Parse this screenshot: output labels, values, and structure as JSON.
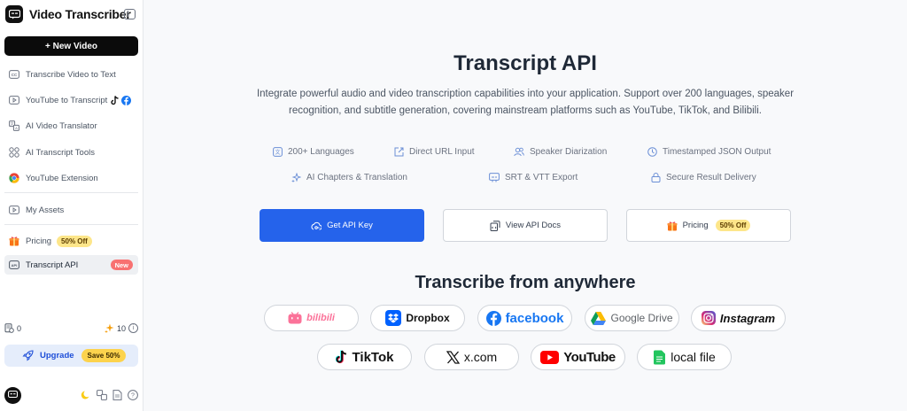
{
  "sidebar": {
    "brand_title": "Video Transcriber",
    "new_video_label": "+ New Video",
    "items": [
      {
        "label": "Transcribe Video to Text",
        "icon": "cc-icon"
      },
      {
        "label": "YouTube to Transcript",
        "icon": "play-square-icon"
      },
      {
        "label": "AI Video Translator",
        "icon": "translate-icon"
      },
      {
        "label": "AI Transcript Tools",
        "icon": "grid-icon"
      },
      {
        "label": "YouTube Extension",
        "icon": "chrome-icon"
      },
      {
        "label": "My Assets",
        "icon": "play-square-icon"
      },
      {
        "label": "Pricing",
        "icon": "gift-icon",
        "badge": "50% Off"
      },
      {
        "label": "Transcript API",
        "icon": "api-icon",
        "badge": "New"
      }
    ],
    "credits_left": "0",
    "credits_right": "10",
    "upgrade_label": "Upgrade",
    "upgrade_badge": "Save 50%"
  },
  "main": {
    "title": "Transcript API",
    "description": "Integrate powerful audio and video transcription capabilities into your application. Support over 200 languages, speaker recognition, and subtitle generation, covering mainstream platforms such as YouTube, TikTok, and Bilibili.",
    "features": [
      "200+ Languages",
      "Direct URL Input",
      "Speaker Diarization",
      "Timestamped JSON Output",
      "AI Chapters & Translation",
      "SRT & VTT Export",
      "Secure Result Delivery"
    ],
    "buttons": {
      "get_api_key": "Get API Key",
      "view_docs": "View API Docs",
      "pricing": "Pricing",
      "pricing_badge": "50% Off"
    },
    "section_title": "Transcribe from anywhere",
    "platforms": [
      "bilibili",
      "Dropbox",
      "facebook",
      "Google Drive",
      "Instagram",
      "TikTok",
      "x.com",
      "YouTube",
      "local file"
    ]
  },
  "colors": {
    "accent": "#2563eb",
    "badge_yellow": "#fde68a",
    "badge_new": "#f87171"
  }
}
